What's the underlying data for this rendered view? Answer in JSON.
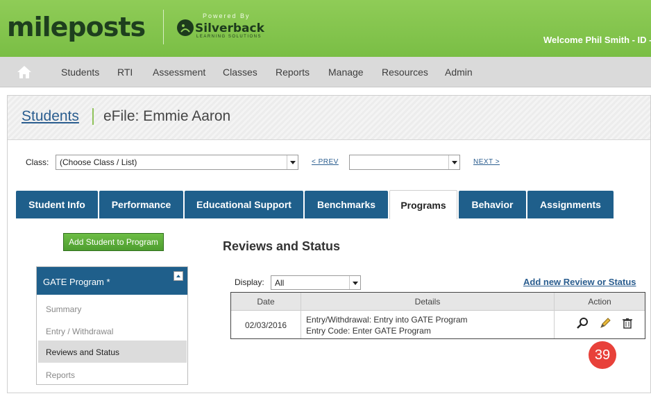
{
  "header": {
    "logo_text": "mileposts",
    "powered_by": "Powered By",
    "partner_name": "Silverback",
    "partner_sub": "LEARNING SOLUTIONS",
    "welcome": "Welcome Phil Smith - ID -"
  },
  "nav": {
    "home_icon": "home-icon",
    "items": [
      "Students",
      "RTI",
      "Assessment",
      "Classes",
      "Reports",
      "Manage",
      "Resources",
      "Admin"
    ]
  },
  "breadcrumb": {
    "link": "Students",
    "title": "eFile: Emmie Aaron"
  },
  "class_selector": {
    "label": "Class:",
    "value": "(Choose Class / List)",
    "prev": "< PREV",
    "second_value": "",
    "next": "NEXT >"
  },
  "tabs": [
    {
      "label": "Student Info"
    },
    {
      "label": "Performance"
    },
    {
      "label": "Educational Support"
    },
    {
      "label": "Benchmarks"
    },
    {
      "label": "Programs",
      "active": true
    },
    {
      "label": "Behavior"
    },
    {
      "label": "Assignments"
    }
  ],
  "left_panel": {
    "add_button": "Add Student to Program",
    "program_title": "GATE Program *",
    "items": [
      "Summary",
      "Entry / Withdrawal",
      "Reviews and Status",
      "Reports"
    ],
    "active_item": "Reviews and Status"
  },
  "reviews": {
    "title": "Reviews and Status",
    "display_label": "Display:",
    "display_value": "All",
    "add_link": "Add new Review or Status",
    "columns": [
      "Date",
      "Details",
      "Action"
    ],
    "rows": [
      {
        "date": "02/03/2016",
        "details_line1": "Entry/Withdrawal: Entry into GATE Program",
        "details_line2": "Entry Code: Enter GATE Program",
        "actions": [
          "view-icon",
          "edit-icon",
          "delete-icon"
        ]
      }
    ]
  },
  "badge": "39",
  "colors": {
    "header_green": "#7abe45",
    "tab_blue": "#1f5f8b",
    "link_blue": "#2a5d8f",
    "button_green": "#4e9e30",
    "badge_red": "#e8413a"
  }
}
